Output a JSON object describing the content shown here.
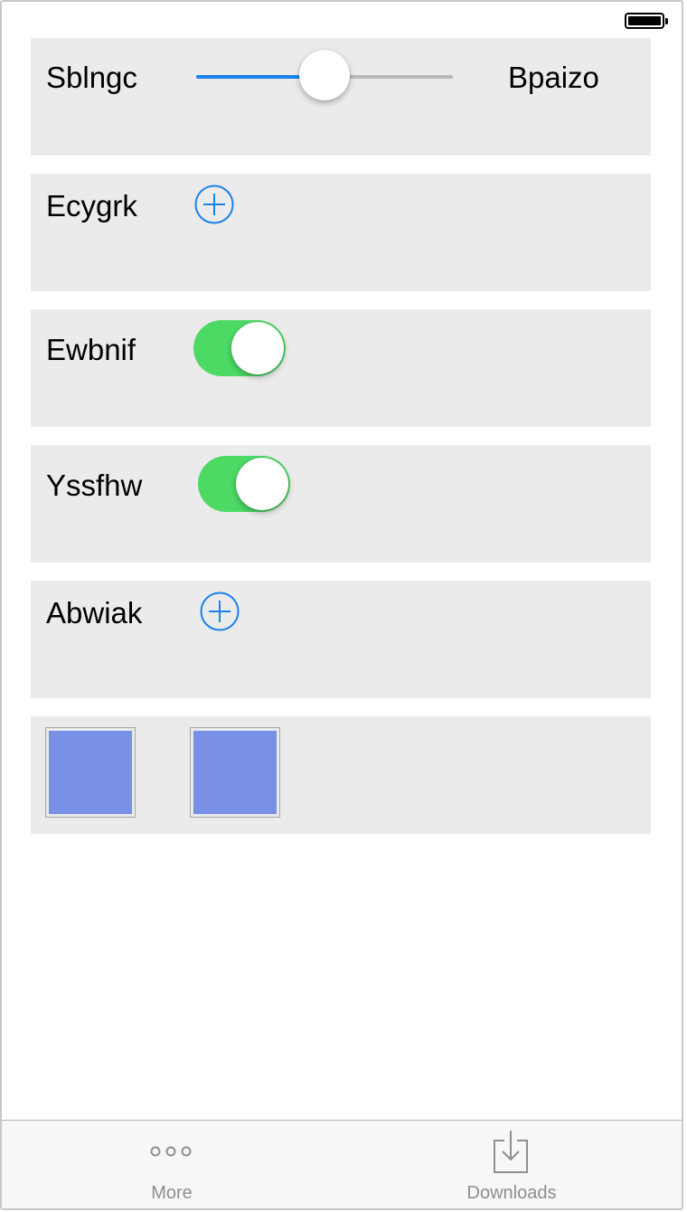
{
  "status_bar": {
    "battery_level": 1.0
  },
  "rows": {
    "slider_row": {
      "label": "Sblngc",
      "max_label": "Bpaizo",
      "value": 0.5
    },
    "add_row_1": {
      "label": "Ecygrk",
      "icon": "plus-circle-icon"
    },
    "switch_row_1": {
      "label": "Ewbnif",
      "on": true
    },
    "switch_row_2": {
      "label": "Yssfhw",
      "on": true
    },
    "add_row_2": {
      "label": "Abwiak",
      "icon": "plus-circle-icon"
    }
  },
  "colors": {
    "accent": "#1a82ed",
    "switch_on": "#4cd964",
    "card_background": "#ebebeb",
    "image_placeholder": "#7890e6",
    "tab_inactive": "#8e8e93"
  },
  "tab_bar": {
    "items": [
      {
        "label": "More",
        "icon": "more-dots-icon"
      },
      {
        "label": "Downloads",
        "icon": "download-tray-icon"
      }
    ]
  }
}
